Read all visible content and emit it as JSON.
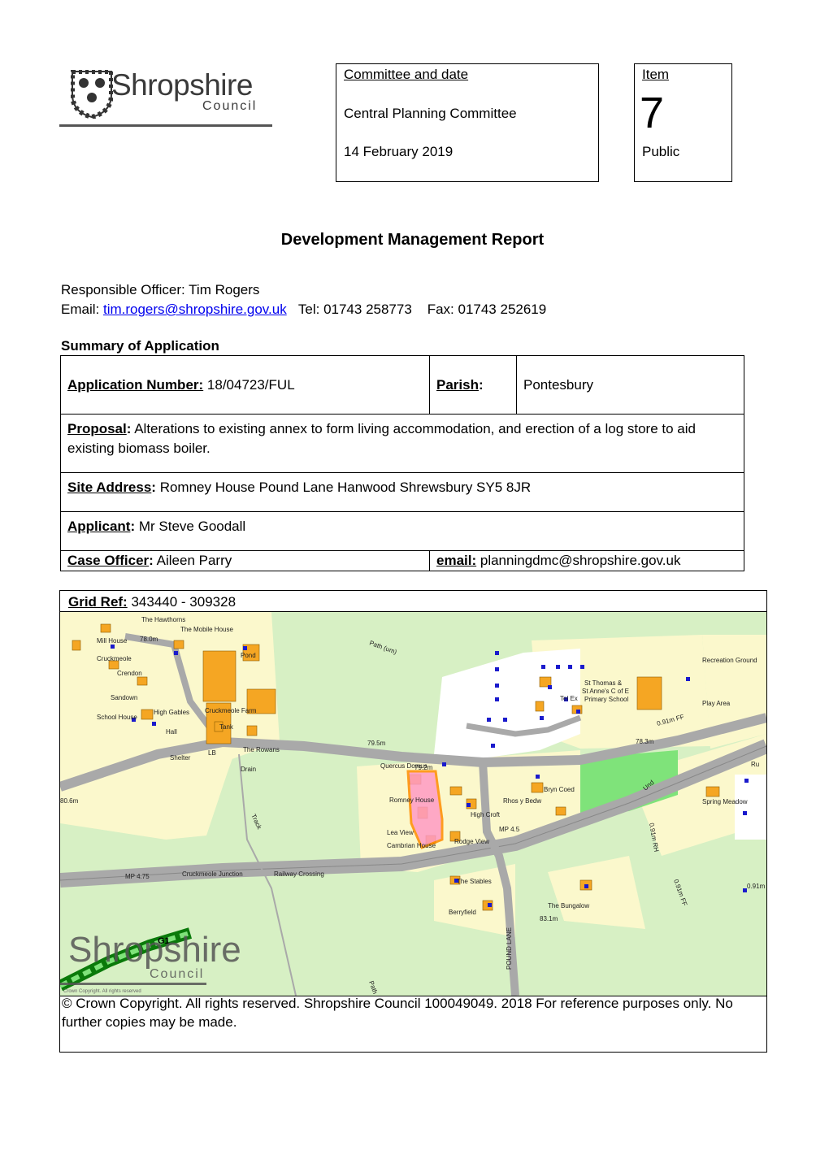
{
  "logo": {
    "word": "Shropshire",
    "sub": "Council"
  },
  "committee": {
    "heading": "Committee and date",
    "name": "Central Planning Committee",
    "date": "14 February 2019"
  },
  "item": {
    "heading": "Item",
    "number": "7",
    "status": "Public"
  },
  "title": "Development Management Report",
  "officer": {
    "responsible": "Responsible Officer: Tim Rogers",
    "email_label": "Email:",
    "email": "tim.rogers@shropshire.gov.uk",
    "tel": "Tel: 01743 258773",
    "fax": "Fax: 01743 252619"
  },
  "summary": {
    "heading": "Summary of Application",
    "application_number_label": "Application Number:",
    "application_number": "18/04723/FUL",
    "parish_label": "Parish",
    "parish": "Pontesbury",
    "proposal_label": "Proposal",
    "proposal": "Alterations to existing annex to form living accommodation, and erection of a log store to aid existing biomass boiler.",
    "site_address_label": "Site Address",
    "site_address": "Romney House Pound Lane Hanwood Shrewsbury SY5 8JR",
    "applicant_label": "Applicant",
    "applicant": "Mr Steve Goodall",
    "case_officer_label": "Case Officer",
    "case_officer": "Aileen Parry",
    "email_label": "email:",
    "email": "planningdmc@shropshire.gov.uk"
  },
  "map": {
    "grid_ref_label": "Grid Ref:",
    "grid_ref": "343440 - 309328",
    "watermark_word": "Shropshire",
    "watermark_sub": "Council",
    "crown_note": "Crown Copyright. All rights reserved",
    "labels": {
      "hawthorns": "The Hawthorns",
      "mobile_house": "The Mobile House",
      "spot_78": "78.0m",
      "mill_house": "Mill House",
      "cruckmeole": "Cruckmeole",
      "pond": "Pond",
      "crendon": "Crendon",
      "sandown": "Sandown",
      "school_house": "School House",
      "high_gables": "High Gables",
      "hall": "Hall",
      "cruckmeole_farm": "Cruckmeole Farm",
      "tank": "Tank",
      "the_rowans": "The Rowans",
      "shelter": "Shelter",
      "lb": "LB",
      "spot_795": "79.5m",
      "spot_792": "79.2m",
      "quercus_domus": "Quercus Domus",
      "drain": "Drain",
      "spot_806": "80.6m",
      "romney_house": "Romney House",
      "lea_view": "Lea View",
      "cambrian_house": "Cambrian House",
      "rodge_view": "Rodge View",
      "high_croft": "High Croft",
      "rhos_y_bedw": "Rhos y Bedw",
      "bryn_coed": "Bryn Coed",
      "mp45": "MP 4.5",
      "mp475": "MP 4.75",
      "cruckmeole_junction": "Cruckmeole Junction",
      "railway_crossing": "Railway Crossing",
      "the_stables": "The Stables",
      "berryfield": "Berryfield",
      "the_bungalow": "The Bungalow",
      "spot_831": "83.1m",
      "pound_lane": "POUND LANE",
      "track": "Track",
      "path": "Path",
      "path_um": "Path (um)",
      "recreation_ground": "Recreation Ground",
      "st_thomas": "St Thomas &",
      "st_annes": "St Anne's C of E",
      "primary_school": "Primary School",
      "tel_ex": "Tel Ex",
      "play_area": "Play Area",
      "spot_783": "78.3m",
      "ff_091_a": "0.91m FF",
      "spring_meadow": "Spring Meadow",
      "ff_091_b": "0.91m RH",
      "ff_091_c": "0.91m FF",
      "spot_091": "0.91m",
      "und": "Und",
      "g1": "G1",
      "ru": "Ru"
    }
  },
  "copyright": "© Crown Copyright. All rights reserved.  Shropshire Council 100049049. 2018 For reference purposes only. No further copies may be made.",
  "colors": {
    "field": "#fbf8cc",
    "open_land": "#d7f0c4",
    "road": "#a9a9a9",
    "building": "#f5a623",
    "green_space": "#7fe37a",
    "site_outline": "#ff8c00",
    "site_fill": "#ff9bc4",
    "marker": "#1a1acc"
  }
}
